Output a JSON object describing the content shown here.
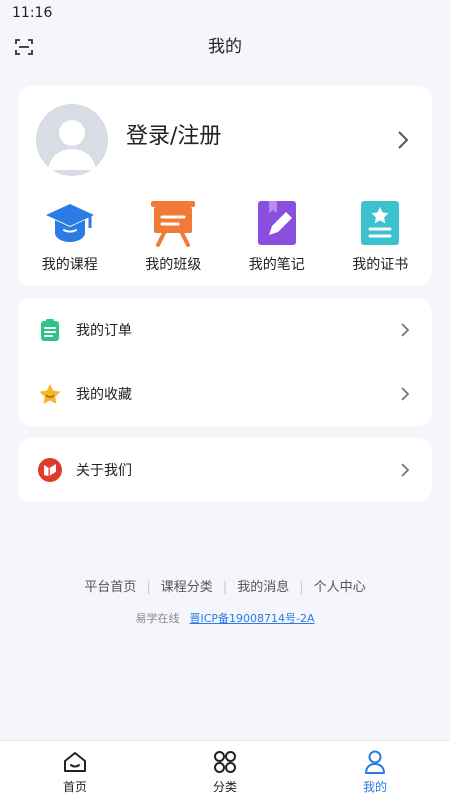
{
  "status_bar": {
    "time": "11:16"
  },
  "header": {
    "title": "我的"
  },
  "profile": {
    "login_label": "登录/注册",
    "shortcuts": [
      {
        "label": "我的课程",
        "icon": "graduation-cap-icon",
        "color": "#2a7be4"
      },
      {
        "label": "我的班级",
        "icon": "presentation-board-icon",
        "color": "#f27a38"
      },
      {
        "label": "我的笔记",
        "icon": "notebook-pen-icon",
        "color": "#8b4fe0"
      },
      {
        "label": "我的证书",
        "icon": "certificate-icon",
        "color": "#3cc2cf"
      }
    ]
  },
  "menu": {
    "orders_label": "我的订单",
    "favorites_label": "我的收藏",
    "about_label": "关于我们"
  },
  "footer": {
    "links": [
      "平台首页",
      "课程分类",
      "我的消息",
      "个人中心"
    ],
    "site_name": "易学在线",
    "icp": "晋ICP备19008714号-2A"
  },
  "tabs": [
    {
      "label": "首页",
      "icon": "home-icon",
      "active": false
    },
    {
      "label": "分类",
      "icon": "category-grid-icon",
      "active": false
    },
    {
      "label": "我的",
      "icon": "user-icon",
      "active": true
    }
  ],
  "colors": {
    "accent": "#2a7be4",
    "background": "#f4f6fb"
  }
}
